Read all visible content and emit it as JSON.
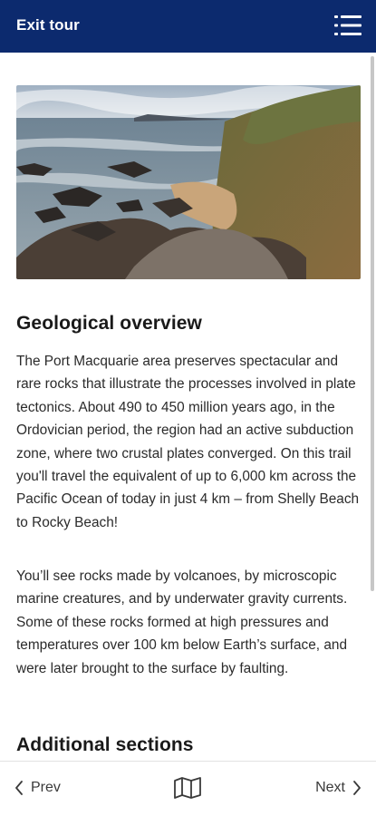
{
  "header": {
    "exit_label": "Exit tour",
    "menu_icon": "hamburger-menu-icon",
    "background": "#0c2a6e"
  },
  "main": {
    "image_alt": "Rocky coastal shoreline",
    "sections": [
      {
        "title": "Geological overview",
        "paragraphs": [
          "The Port Macquarie area preserves spectacular and rare rocks that illustrate the processes involved in plate tectonics. About 490 to 450 million years ago, in the Ordovician period, the region had an active subduction zone, where two crustal plates converged. On this trail you'll travel the equivalent of up to 6,000 km across the Pacific Ocean of today in just 4 km – from Shelly Beach to Rocky Beach!",
          "You’ll see rocks made by volcanoes, by microscopic marine creatures, and by underwater gravity currents. Some of these rocks formed at high pressures and temperatures over 100 km below Earth’s surface, and were later brought to the surface by faulting."
        ]
      },
      {
        "title": "Additional sections"
      }
    ]
  },
  "footer": {
    "prev_label": "Prev",
    "next_label": "Next",
    "map_icon": "map-icon"
  }
}
